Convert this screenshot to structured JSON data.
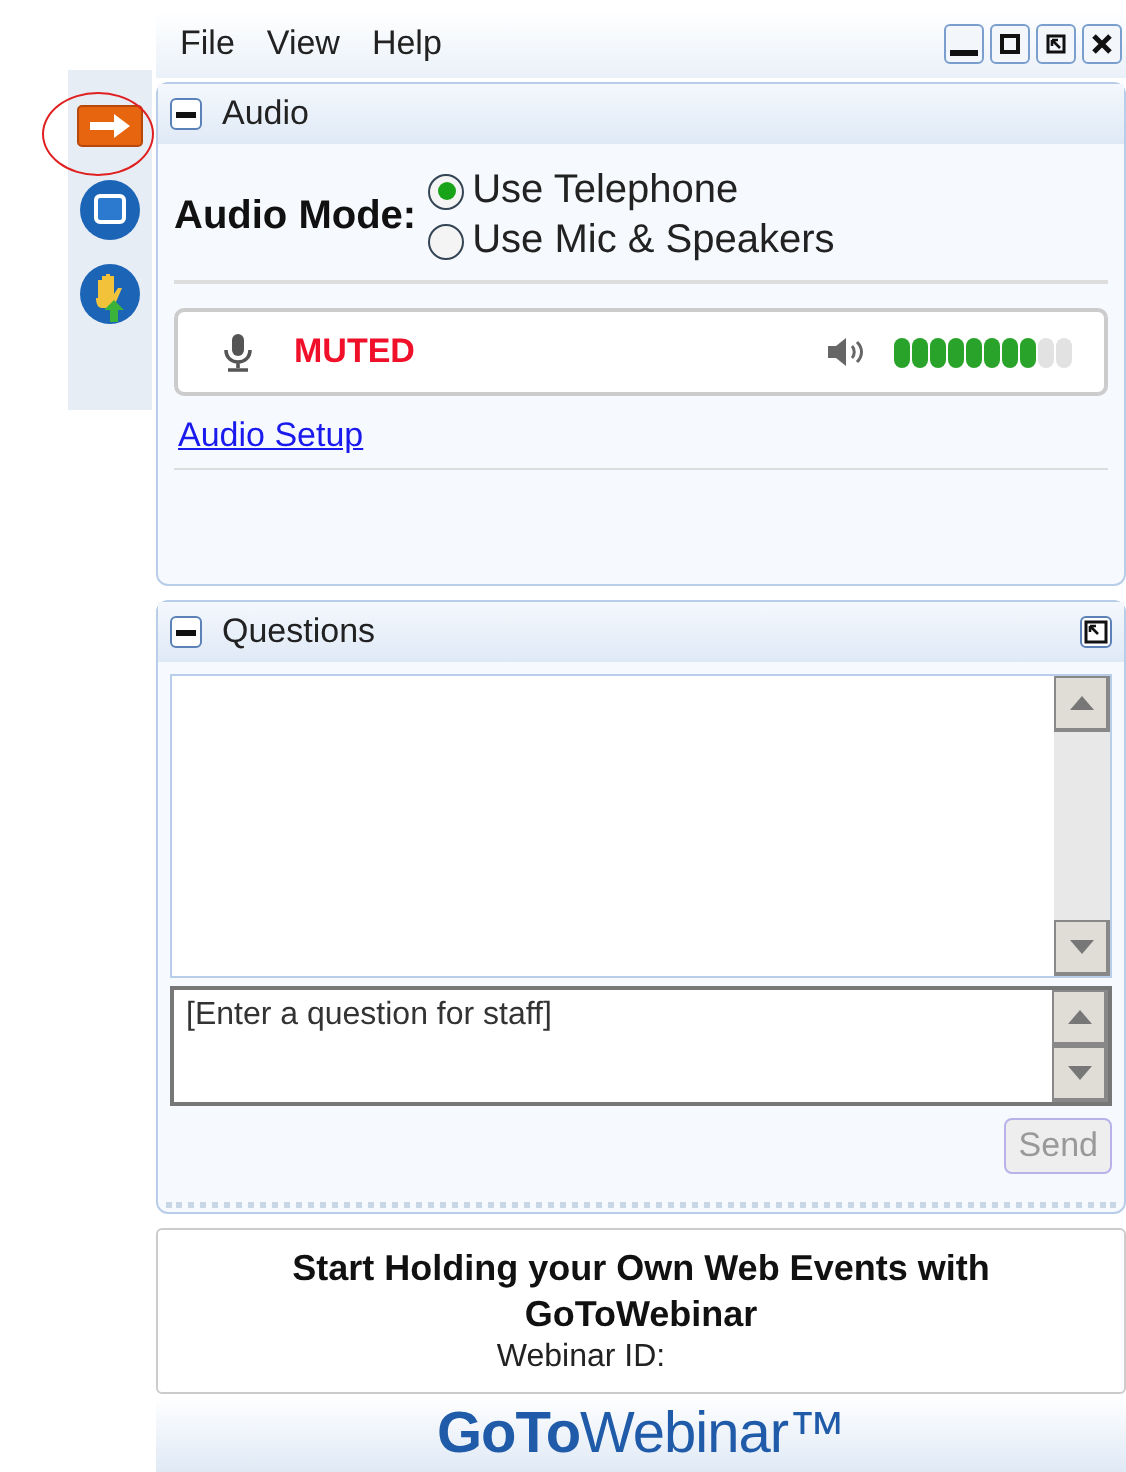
{
  "toolbar": {
    "items": [
      {
        "kind": "arrow",
        "highlighted": true
      },
      {
        "kind": "window",
        "highlighted": false
      },
      {
        "kind": "hand",
        "highlighted": false
      }
    ]
  },
  "menu": [
    "File",
    "View",
    "Help"
  ],
  "window_controls": [
    {
      "kind": "minimize"
    },
    {
      "kind": "maximize"
    },
    {
      "kind": "restore"
    },
    {
      "kind": "close"
    }
  ],
  "audio": {
    "title": "Audio",
    "mode_label": "Audio Mode:",
    "options": [
      {
        "label": "Use Telephone",
        "selected": true
      },
      {
        "label": "Use Mic & Speakers",
        "selected": false
      }
    ],
    "status": "MUTED",
    "muted": true,
    "level": 0.8,
    "setup_link": "Audio Setup"
  },
  "questions": {
    "title": "Questions",
    "placeholder": "[Enter a question for staff]",
    "send": {
      "label": "Send",
      "disabled": true
    }
  },
  "promo": {
    "headline": "Start Holding your Own Web Events with GoToWebinar",
    "webinar_id": "Webinar ID:"
  },
  "logo": "**GoTo**Webinar™"
}
